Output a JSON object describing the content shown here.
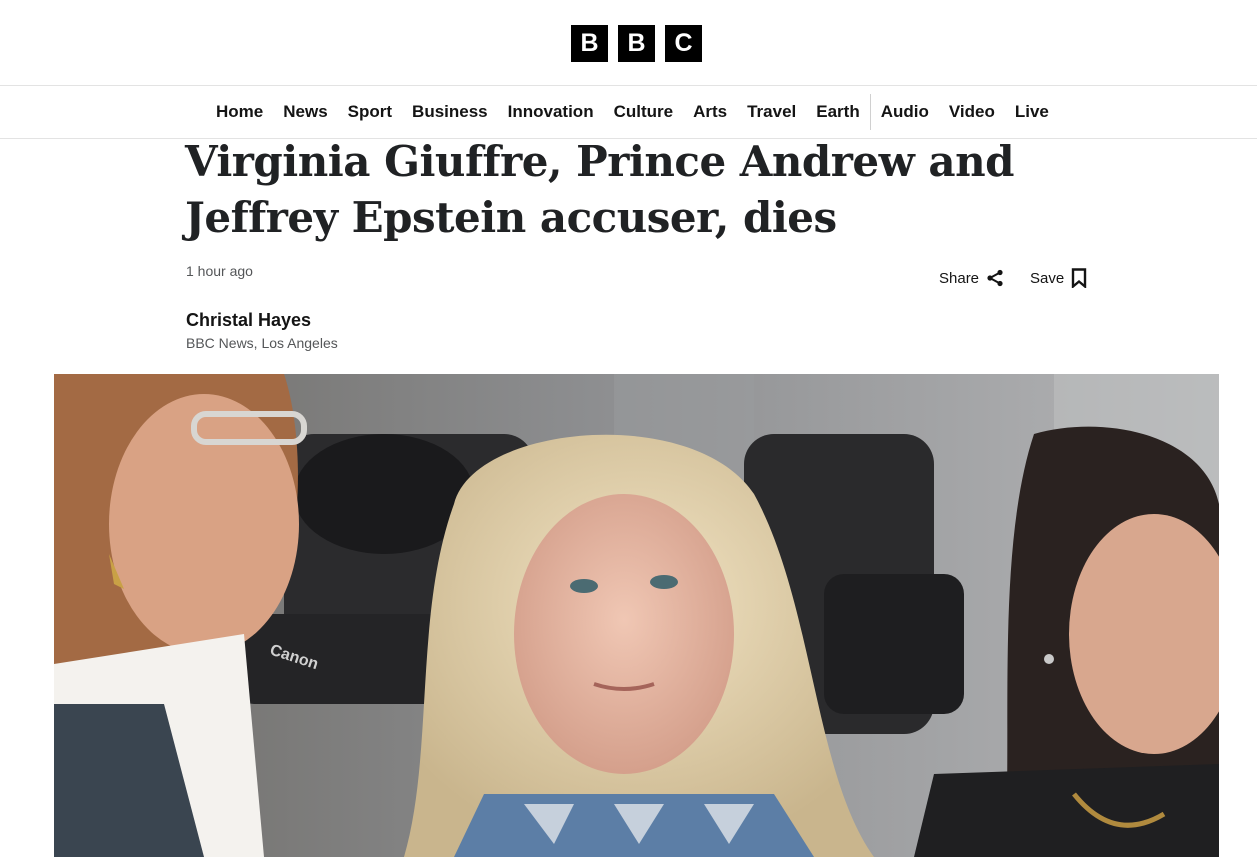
{
  "logo": {
    "letters": [
      "B",
      "B",
      "C"
    ]
  },
  "nav": {
    "items": [
      "Home",
      "News",
      "Sport",
      "Business",
      "Innovation",
      "Culture",
      "Arts",
      "Travel",
      "Earth"
    ],
    "secondary": [
      "Audio",
      "Video",
      "Live"
    ]
  },
  "article": {
    "headline": "Virginia Giuffre, Prince Andrew and Jeffrey Epstein accuser, dies",
    "timestamp": "1 hour ago",
    "share_label": "Share",
    "save_label": "Save",
    "author": "Christal Hayes",
    "author_role": "BBC News, Los Angeles"
  },
  "hero_image": {
    "description_icon": "news-photo",
    "camera_brand": "Canon"
  }
}
